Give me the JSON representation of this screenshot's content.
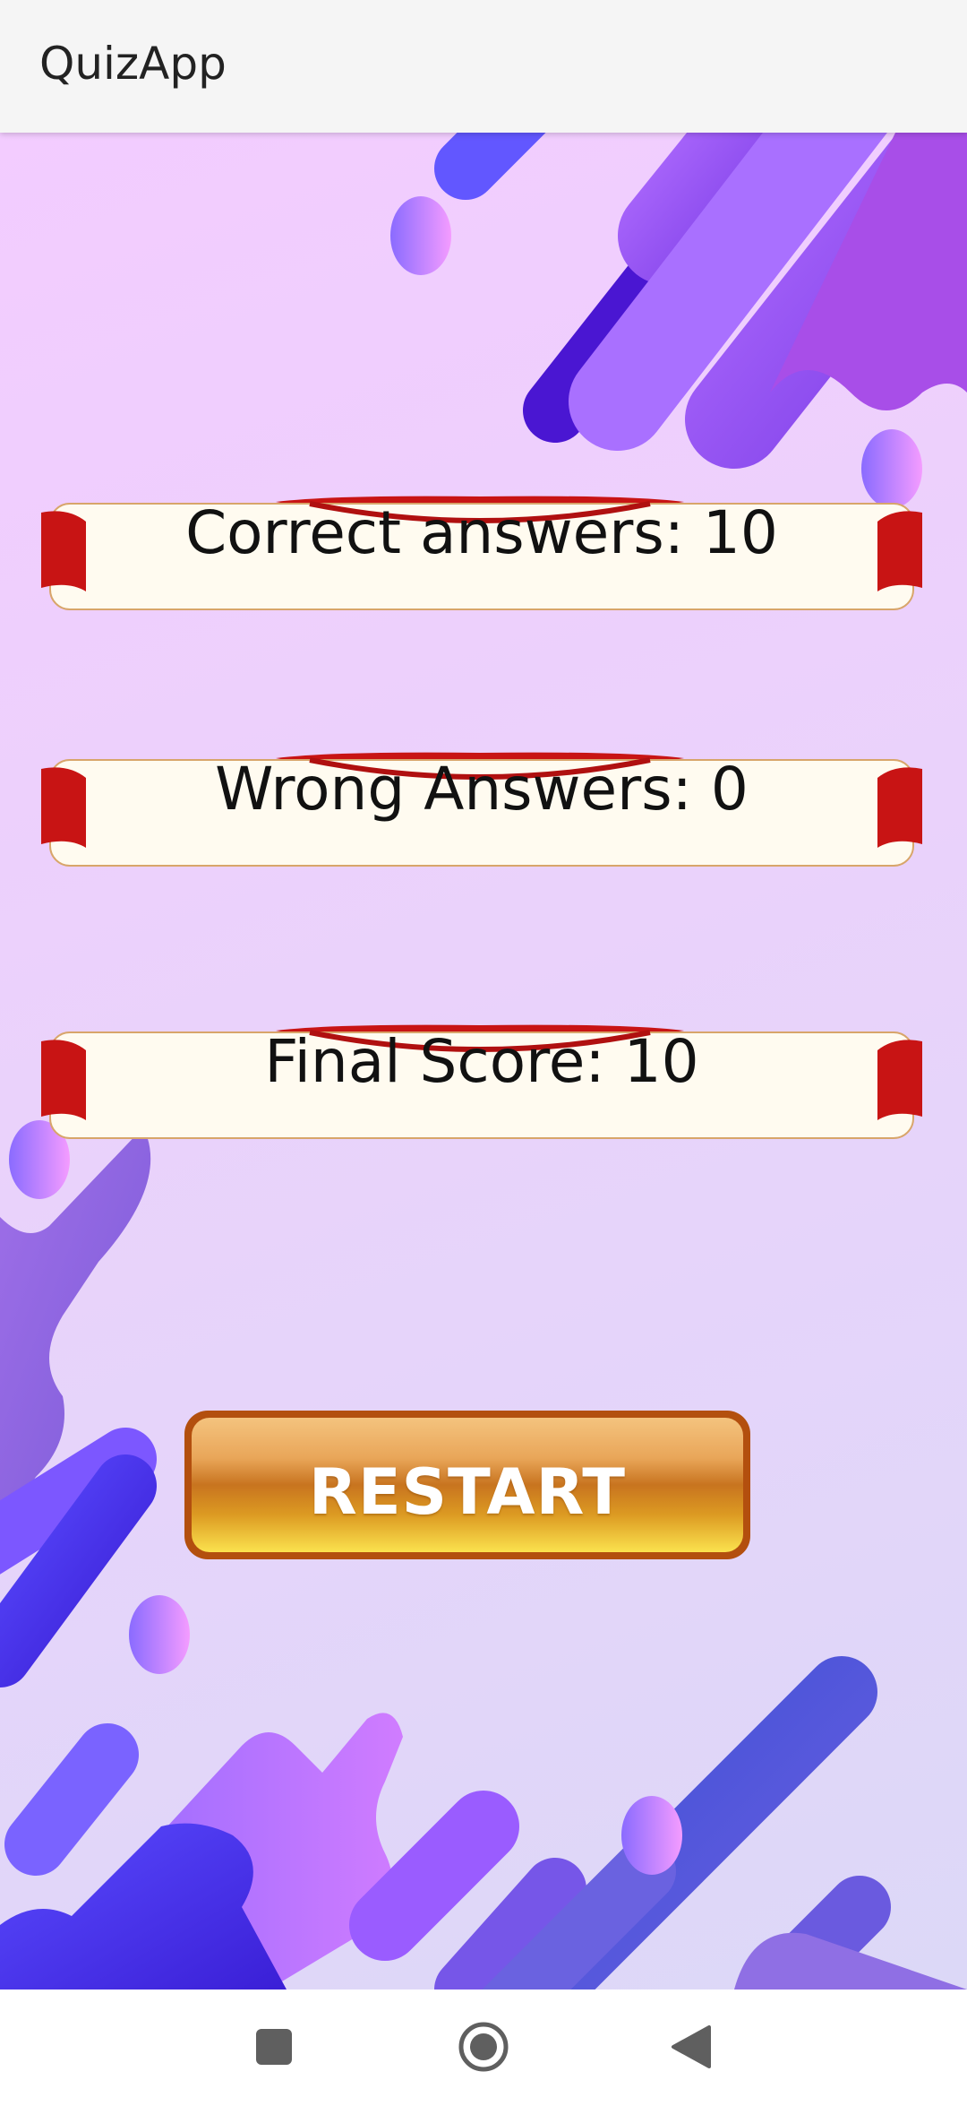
{
  "app_bar": {
    "title": "QuizApp"
  },
  "results": {
    "correct_label": "Correct answers: 10",
    "wrong_label": "Wrong Answers: 0",
    "score_label": "Final Score: 10"
  },
  "actions": {
    "restart_label": "RESTART"
  },
  "nav": {
    "recents_icon": "square-icon",
    "home_icon": "circle-icon",
    "back_icon": "triangle-back-icon"
  },
  "colors": {
    "banner_ribbon": "#c81414",
    "banner_body": "#fffbf0",
    "button_border": "#b34f0e",
    "background": "#ead2fb"
  }
}
